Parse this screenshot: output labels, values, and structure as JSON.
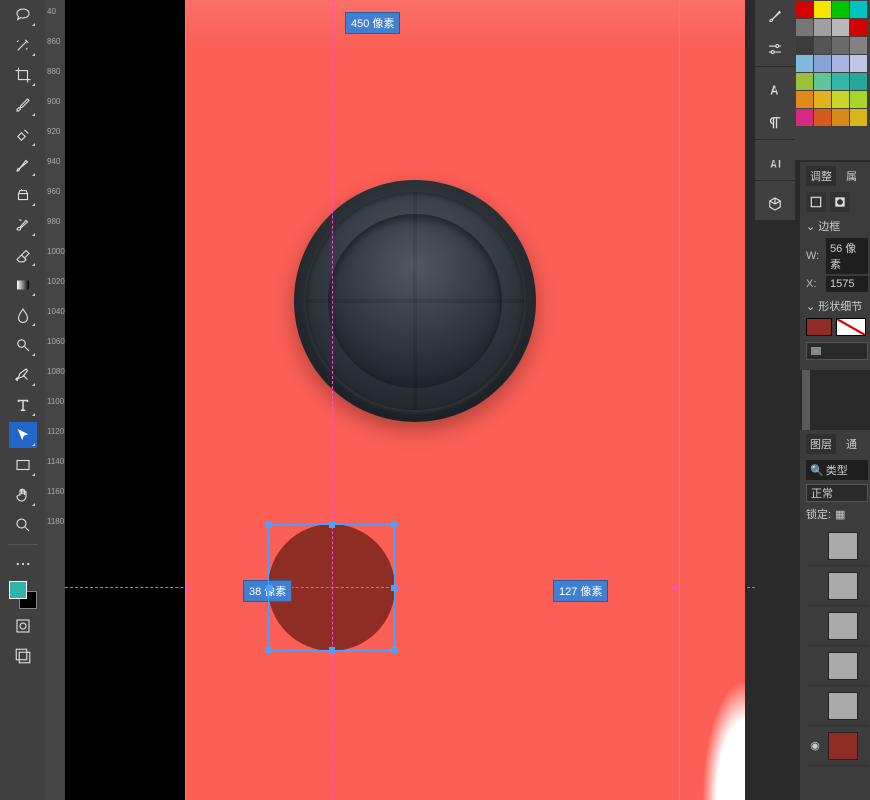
{
  "measurements": {
    "top": "450 像素",
    "left": "38 像素",
    "right": "127 像素"
  },
  "swatch_colors": [
    "#d50000",
    "#f7e400",
    "#00c400",
    "#00c4c4",
    "#777777",
    "#a0a0a0",
    "#b8b8b8",
    "#d50000",
    "#3c3c3c",
    "#555555",
    "#6a6a6a",
    "#828282",
    "#7fbada",
    "#89a3d6",
    "#a6b6e0",
    "#c0c4e6",
    "#9cbf3e",
    "#63c49c",
    "#35b6a6",
    "#27a69a",
    "#e08a1a",
    "#e0b31a",
    "#c9d629",
    "#a7d629",
    "#d62981",
    "#d65a1a",
    "#d68a1a",
    "#d6b61a"
  ],
  "panels": {
    "tabs": {
      "adjust": "调整",
      "props": "属"
    },
    "border_section": "边框",
    "W": "W:",
    "W_val": "56 像素",
    "X": "X:",
    "X_val": "1575",
    "shape_section": "形状细节"
  },
  "layers": {
    "tabs": {
      "layers": "图层",
      "channels": "通"
    },
    "filter_label": "类型",
    "blend": "正常",
    "lock_label": "锁定:"
  },
  "ruler_ticks": [
    "40",
    "860",
    "880",
    "900",
    "920",
    "940",
    "960",
    "980",
    "1000",
    "1020",
    "1040",
    "1060",
    "1080",
    "1100",
    "1120",
    "1140",
    "1160",
    "1180"
  ]
}
